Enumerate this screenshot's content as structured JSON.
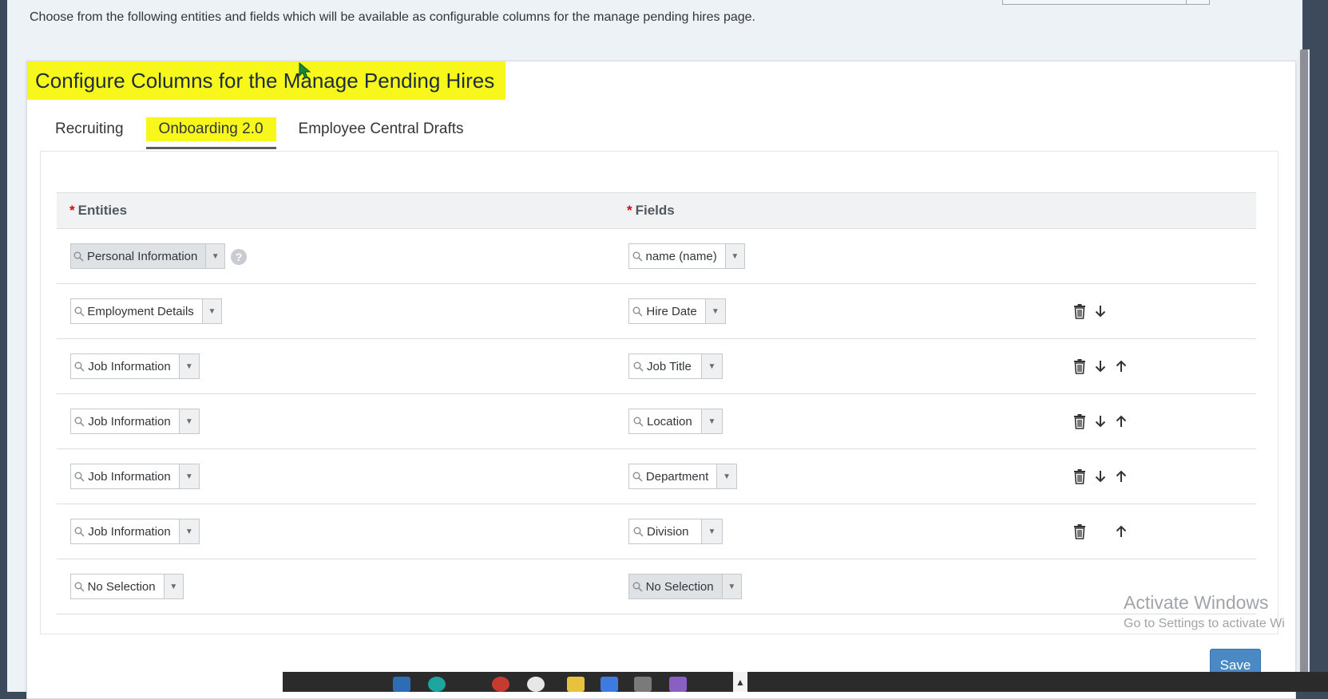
{
  "intro_text": "Choose from the following entities and fields which will be available as configurable columns for the manage pending hires page.",
  "card_title": "Configure Columns for the Manage Pending Hires",
  "tabs": [
    {
      "label": "Recruiting",
      "active": false
    },
    {
      "label": "Onboarding 2.0",
      "active": true
    },
    {
      "label": "Employee Central Drafts",
      "active": false
    }
  ],
  "table": {
    "entities_header": "Entities",
    "fields_header": "Fields",
    "required_marker": "*",
    "rows": [
      {
        "entity": "Personal Information",
        "field": "name (name)",
        "entity_disabled": true,
        "help": "?",
        "actions": []
      },
      {
        "entity": "Employment Details",
        "field": "Hire Date",
        "actions": [
          "delete",
          "down"
        ]
      },
      {
        "entity": "Job Information",
        "field": "Job Title",
        "actions": [
          "delete",
          "down",
          "up"
        ]
      },
      {
        "entity": "Job Information",
        "field": "Location",
        "actions": [
          "delete",
          "down",
          "up"
        ]
      },
      {
        "entity": "Job Information",
        "field": "Department",
        "actions": [
          "delete",
          "down",
          "up"
        ]
      },
      {
        "entity": "Job Information",
        "field": "Division",
        "actions": [
          "delete",
          "up"
        ]
      },
      {
        "entity": "No Selection",
        "field": "No Selection",
        "field_disabled": true,
        "actions": []
      }
    ]
  },
  "watermark": {
    "line1": "Activate Windows",
    "line2": "Go to Settings to activate Wi"
  },
  "save_label": "Save",
  "colors": {
    "highlight": "#f7f71c",
    "save_button": "#4a89c4",
    "required": "#e00000"
  },
  "icons": {
    "search": "search-icon",
    "dropdown": "chevron-down-icon",
    "delete": "trash-icon",
    "down": "arrow-down-icon",
    "up": "arrow-up-icon",
    "help": "help-circle-icon"
  }
}
